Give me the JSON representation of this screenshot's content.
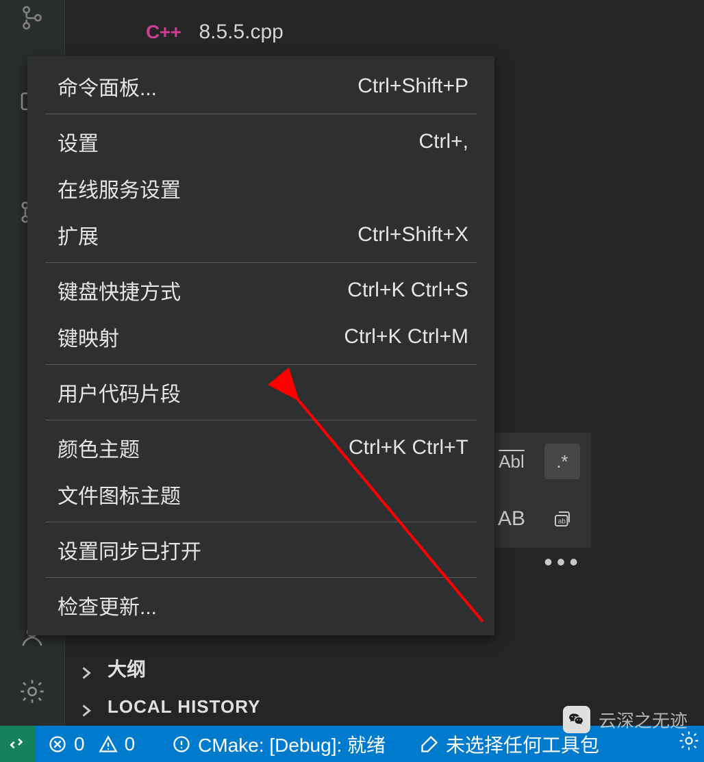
{
  "file": {
    "icon_text": "C++",
    "name": "8.5.5.cpp"
  },
  "menu": {
    "groups": [
      [
        {
          "label": "命令面板...",
          "shortcut": "Ctrl+Shift+P"
        }
      ],
      [
        {
          "label": "设置",
          "shortcut": "Ctrl+,"
        },
        {
          "label": "在线服务设置",
          "shortcut": ""
        },
        {
          "label": "扩展",
          "shortcut": "Ctrl+Shift+X"
        }
      ],
      [
        {
          "label": "键盘快捷方式",
          "shortcut": "Ctrl+K Ctrl+S"
        },
        {
          "label": "键映射",
          "shortcut": "Ctrl+K Ctrl+M"
        }
      ],
      [
        {
          "label": "用户代码片段",
          "shortcut": ""
        }
      ],
      [
        {
          "label": "颜色主题",
          "shortcut": "Ctrl+K Ctrl+T"
        },
        {
          "label": "文件图标主题",
          "shortcut": ""
        }
      ],
      [
        {
          "label": "设置同步已打开",
          "shortcut": ""
        }
      ],
      [
        {
          "label": "检查更新...",
          "shortcut": ""
        }
      ]
    ]
  },
  "search_widget": {
    "a_label": "a",
    "abl_label": "Abl",
    "regex_label": ".*",
    "ab_label": "AB"
  },
  "outline": {
    "label": "大纲"
  },
  "local_history": {
    "label": "LOCAL HISTORY"
  },
  "status": {
    "errors": "0",
    "warnings": "0",
    "cmake": "CMake: [Debug]: 就绪",
    "kit": "未选择任何工具包"
  },
  "watermark": {
    "text": "云深之无迹"
  }
}
